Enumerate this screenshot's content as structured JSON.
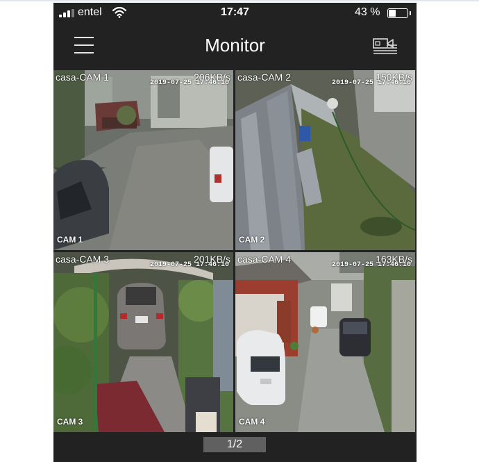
{
  "status_bar": {
    "carrier": "entel",
    "time": "17:47",
    "battery_percent": "43 %",
    "battery_level": 0.43,
    "signal_bars": 3
  },
  "header": {
    "title": "Monitor",
    "left_icon": "menu-icon",
    "right_icon": "recordings-icon"
  },
  "cameras": [
    {
      "name": "casa-CAM 1",
      "rate": "206KB/s",
      "timestamp": "2019-07-25 17:46:10",
      "label": "CAM 1",
      "selected": true
    },
    {
      "name": "casa-CAM 2",
      "rate": "150KB/s",
      "timestamp": "2019-07-25 17:46:10",
      "label": "CAM 2",
      "selected": false
    },
    {
      "name": "casa-CAM 3",
      "rate": "201KB/s",
      "timestamp": "2019-07-25 17:46:10",
      "label": "CAM 3",
      "selected": false
    },
    {
      "name": "casa-CAM 4",
      "rate": "163KB/s",
      "timestamp": "2019-07-25 17:46:10",
      "label": "CAM 4",
      "selected": false
    }
  ],
  "pager": {
    "indicator": "1/2"
  },
  "colors": {
    "app_background": "#222222",
    "selection_border": "#5fc4e8",
    "page_indicator": "#606060"
  }
}
